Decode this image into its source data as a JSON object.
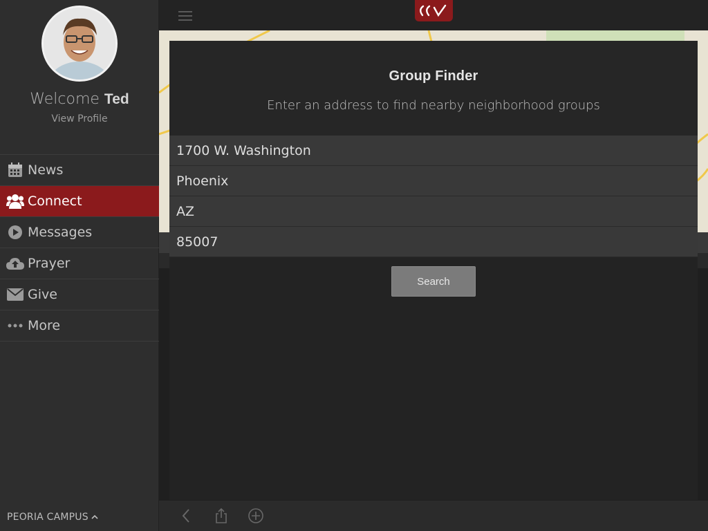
{
  "sidebar": {
    "welcome_prefix": "Welcome",
    "user_name": "Ted",
    "view_profile": "View Profile",
    "items": [
      {
        "label": "News",
        "icon": "calendar-icon",
        "active": false
      },
      {
        "label": "Connect",
        "icon": "users-icon",
        "active": true
      },
      {
        "label": "Messages",
        "icon": "play-circle-icon",
        "active": false
      },
      {
        "label": "Prayer",
        "icon": "cloud-upload-icon",
        "active": false
      },
      {
        "label": "Give",
        "icon": "envelope-icon",
        "active": false
      },
      {
        "label": "More",
        "icon": "ellipsis-icon",
        "active": false
      }
    ],
    "campus": "PEORIA CAMPUS"
  },
  "colors": {
    "accent": "#8b1a1c",
    "sidebar_bg": "#2e2e2e",
    "modal_bg": "#232323",
    "field_bg": "#393939"
  },
  "modal": {
    "title": "Group Finder",
    "subtitle": "Enter an address to find nearby neighborhood groups",
    "fields": {
      "street": "1700 W. Washington",
      "city": "Phoenix",
      "state": "AZ",
      "zip": "85007"
    },
    "search_label": "Search"
  }
}
